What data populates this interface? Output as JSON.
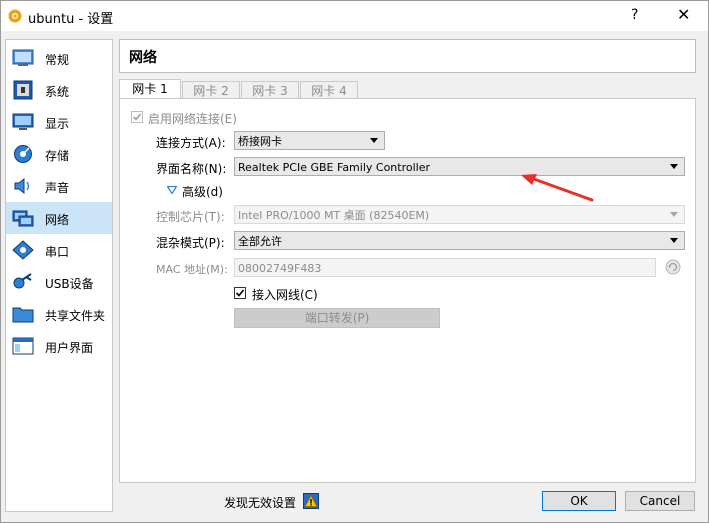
{
  "window": {
    "title": "ubuntu - 设置",
    "help": "?",
    "close": "✕"
  },
  "sidebar": {
    "items": [
      {
        "label": "常规",
        "icon": "general-icon"
      },
      {
        "label": "系统",
        "icon": "system-icon"
      },
      {
        "label": "显示",
        "icon": "display-icon"
      },
      {
        "label": "存储",
        "icon": "storage-icon"
      },
      {
        "label": "声音",
        "icon": "audio-icon"
      },
      {
        "label": "网络",
        "icon": "network-icon",
        "selected": true
      },
      {
        "label": "串口",
        "icon": "serial-port-icon"
      },
      {
        "label": "USB设备",
        "icon": "usb-icon"
      },
      {
        "label": "共享文件夹",
        "icon": "shared-folder-icon"
      },
      {
        "label": "用户界面",
        "icon": "user-interface-icon"
      }
    ]
  },
  "header": {
    "title": "网络"
  },
  "tabs": [
    {
      "label": "网卡 1",
      "active": true
    },
    {
      "label": "网卡 2"
    },
    {
      "label": "网卡 3"
    },
    {
      "label": "网卡 4"
    }
  ],
  "adapter": {
    "enable_label": "启用网络连接(E)",
    "enable_checked": true,
    "attached_label": "连接方式(A):",
    "attached_value": "桥接网卡",
    "name_label": "界面名称(N):",
    "name_value": "Realtek PCIe GBE Family Controller",
    "advanced_label": "高级(d)",
    "chip_label": "控制芯片(T):",
    "chip_value": "Intel PRO/1000 MT 桌面 (82540EM)",
    "promisc_label": "混杂模式(P):",
    "promisc_value": "全部允许",
    "mac_label": "MAC 地址(M):",
    "mac_value": "08002749F483",
    "cable_label": "接入网线(C)",
    "cable_checked": true,
    "port_forward_label": "端口转发(P)"
  },
  "footer": {
    "invalid_label": "发现无效设置",
    "ok_label": "OK",
    "cancel_label": "Cancel"
  },
  "colors": {
    "selection": "#cce4f7",
    "annotation_arrow": "#e8302a",
    "ok_border": "#0078d7"
  }
}
